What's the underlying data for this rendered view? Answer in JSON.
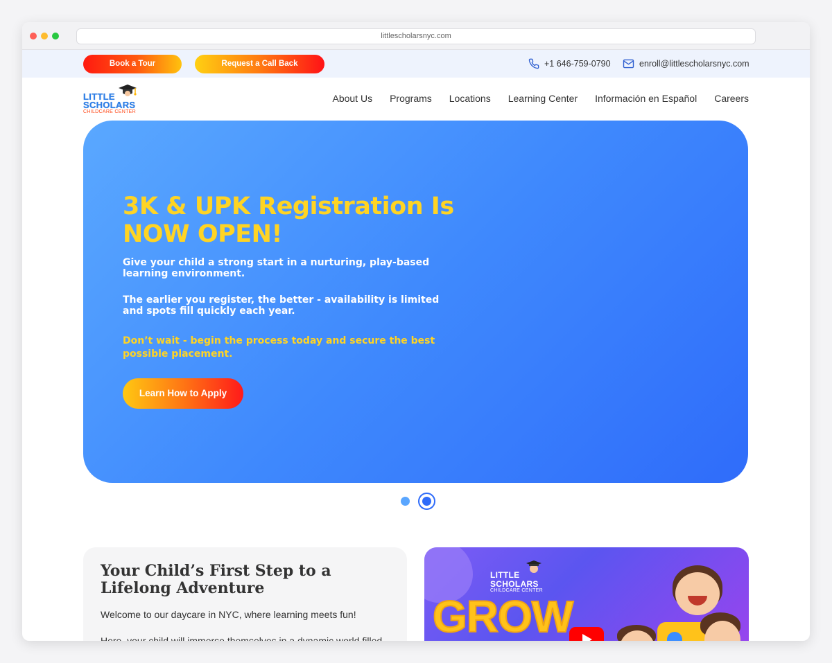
{
  "browser": {
    "url": "littlescholarsnyc.com",
    "dot_colors": [
      "#fe5f57",
      "#febc2e",
      "#28c840"
    ]
  },
  "topbar": {
    "book_tour": "Book a Tour",
    "call_back": "Request a Call Back",
    "phone": "+1 646-759-0790",
    "email": "enroll@littlescholarsnyc.com"
  },
  "logo": {
    "line1": "LITTLE",
    "line2": "SCHOLARS",
    "sub": "CHILDCARE CENTER"
  },
  "nav": {
    "items": [
      "About Us",
      "Programs",
      "Locations",
      "Learning Center",
      "Información en Español",
      "Careers"
    ]
  },
  "hero": {
    "title": "3K & UPK Registration Is NOW OPEN!",
    "p1": "Give your child a strong start in a nurturing, play-based learning environment.",
    "p2": "The earlier you register, the better - availability is limited and spots fill quickly each year.",
    "p3": "Don’t wait - begin the process today and secure the best possible placement.",
    "cta": "Learn How to Apply",
    "gradient": [
      "#5aa8ff",
      "#2f6cfa"
    ],
    "accent": "#ffd424"
  },
  "carousel": {
    "slides": 2,
    "active": 2
  },
  "intro": {
    "title": "Your Child’s First Step to a Lifelong Adventure",
    "p1": "Welcome to our daycare in NYC, where learning meets fun!",
    "p2": "Here, your child will immerse themselves in a dynamic world filled"
  },
  "video": {
    "logo_line1": "LITTLE",
    "logo_line2": "SCHOLARS",
    "logo_sub": "CHILDCARE CENTER",
    "headline": "GROW",
    "play_icon": "youtube-play-icon"
  }
}
